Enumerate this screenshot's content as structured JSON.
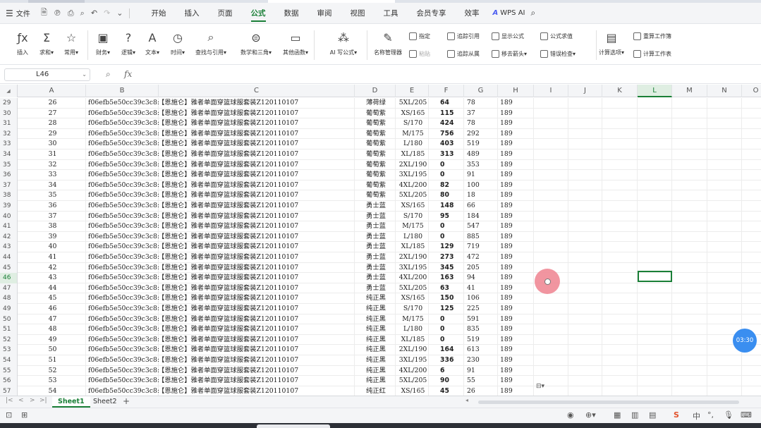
{
  "menubar": {
    "file_label": "文件",
    "tabs": [
      "开始",
      "插入",
      "页面",
      "公式",
      "数据",
      "审阅",
      "视图",
      "工具",
      "会员专享",
      "效率"
    ],
    "active_tab": "公式",
    "wps_ai_label": "WPS AI"
  },
  "ribbon": {
    "big_buttons": [
      {
        "label": "插入",
        "icon": "fx-icon"
      },
      {
        "label": "求和▾",
        "icon": "sum-icon"
      },
      {
        "label": "常用▾",
        "icon": "star-icon"
      },
      {
        "label": "财务▾",
        "icon": "finance-icon"
      },
      {
        "label": "逻辑▾",
        "icon": "logic-icon"
      },
      {
        "label": "文本▾",
        "icon": "text-icon"
      },
      {
        "label": "时间▾",
        "icon": "clock-icon"
      },
      {
        "label": "查找与引用▾",
        "icon": "lookup-icon"
      },
      {
        "label": "数学和三角▾",
        "icon": "math-icon"
      },
      {
        "label": "其他函数▾",
        "icon": "more-functions-icon"
      },
      {
        "label": "AI 写公式▾",
        "icon": "ai-formula-icon"
      },
      {
        "label": "名称管理器",
        "icon": "name-manager-icon"
      }
    ],
    "small_buttons": [
      {
        "label": "指定",
        "icon": "specify-icon"
      },
      {
        "label": "粘贴",
        "icon": "paste-icon"
      },
      {
        "label": "追踪引用",
        "icon": "trace-precedents-icon"
      },
      {
        "label": "显示公式",
        "icon": "show-formula-icon"
      },
      {
        "label": "公式求值",
        "icon": "evaluate-formula-icon"
      },
      {
        "label": "追踪从属",
        "icon": "trace-dependents-icon"
      },
      {
        "label": "移去箭头▾",
        "icon": "remove-arrows-icon"
      },
      {
        "label": "错误检查▾",
        "icon": "error-check-icon"
      }
    ],
    "calc_buttons": [
      {
        "label": "计算选项▾",
        "icon": "calc-options-icon"
      },
      {
        "label": "重算工作簿",
        "icon": "recalc-workbook-icon"
      },
      {
        "label": "计算工作表",
        "icon": "calc-sheet-icon"
      }
    ]
  },
  "formula_bar": {
    "cell_ref": "L46",
    "fx": "fx",
    "content": ""
  },
  "columns": [
    "A",
    "B",
    "C",
    "D",
    "E",
    "F",
    "G",
    "H",
    "I",
    "J",
    "K",
    "L",
    "M",
    "N",
    "O"
  ],
  "selected_column": "L",
  "selected_row": "46",
  "rows": [
    {
      "r": "29",
      "a": "26",
      "b": "f06efb5e50cc39c3c8:",
      "c": "【恩施仑】雅者单面穿篮球服套装Z120110107",
      "d": "薄荷绿",
      "e": "5XL/205",
      "f": "64",
      "g": "78",
      "h": "189"
    },
    {
      "r": "30",
      "a": "27",
      "b": "f06efb5e50cc39c3c8:",
      "c": "【恩施仑】雅者单面穿篮球服套装Z120110107",
      "d": "葡萄紫",
      "e": "XS/165",
      "f": "115",
      "g": "37",
      "h": "189"
    },
    {
      "r": "31",
      "a": "28",
      "b": "f06efb5e50cc39c3c8:",
      "c": "【恩施仑】雅者单面穿篮球服套装Z120110107",
      "d": "葡萄紫",
      "e": "S/170",
      "f": "424",
      "g": "78",
      "h": "189"
    },
    {
      "r": "32",
      "a": "29",
      "b": "f06efb5e50cc39c3c8:",
      "c": "【恩施仑】雅者单面穿篮球服套装Z120110107",
      "d": "葡萄紫",
      "e": "M/175",
      "f": "756",
      "g": "292",
      "h": "189"
    },
    {
      "r": "33",
      "a": "30",
      "b": "f06efb5e50cc39c3c8:",
      "c": "【恩施仑】雅者单面穿篮球服套装Z120110107",
      "d": "葡萄紫",
      "e": "L/180",
      "f": "403",
      "g": "519",
      "h": "189"
    },
    {
      "r": "34",
      "a": "31",
      "b": "f06efb5e50cc39c3c8:",
      "c": "【恩施仑】雅者单面穿篮球服套装Z120110107",
      "d": "葡萄紫",
      "e": "XL/185",
      "f": "313",
      "g": "489",
      "h": "189"
    },
    {
      "r": "35",
      "a": "32",
      "b": "f06efb5e50cc39c3c8:",
      "c": "【恩施仑】雅者单面穿篮球服套装Z120110107",
      "d": "葡萄紫",
      "e": "2XL/190",
      "f": "0",
      "g": "353",
      "h": "189"
    },
    {
      "r": "36",
      "a": "33",
      "b": "f06efb5e50cc39c3c8:",
      "c": "【恩施仑】雅者单面穿篮球服套装Z120110107",
      "d": "葡萄紫",
      "e": "3XL/195",
      "f": "0",
      "g": "91",
      "h": "189"
    },
    {
      "r": "37",
      "a": "34",
      "b": "f06efb5e50cc39c3c8:",
      "c": "【恩施仑】雅者单面穿篮球服套装Z120110107",
      "d": "葡萄紫",
      "e": "4XL/200",
      "f": "82",
      "g": "100",
      "h": "189"
    },
    {
      "r": "38",
      "a": "35",
      "b": "f06efb5e50cc39c3c8:",
      "c": "【恩施仑】雅者单面穿篮球服套装Z120110107",
      "d": "葡萄紫",
      "e": "5XL/205",
      "f": "80",
      "g": "18",
      "h": "189"
    },
    {
      "r": "39",
      "a": "36",
      "b": "f06efb5e50cc39c3c8:",
      "c": "【恩施仑】雅者单面穿篮球服套装Z120110107",
      "d": "勇士蓝",
      "e": "XS/165",
      "f": "148",
      "g": "66",
      "h": "189"
    },
    {
      "r": "40",
      "a": "37",
      "b": "f06efb5e50cc39c3c8:",
      "c": "【恩施仑】雅者单面穿篮球服套装Z120110107",
      "d": "勇士蓝",
      "e": "S/170",
      "f": "95",
      "g": "184",
      "h": "189"
    },
    {
      "r": "41",
      "a": "38",
      "b": "f06efb5e50cc39c3c8:",
      "c": "【恩施仑】雅者单面穿篮球服套装Z120110107",
      "d": "勇士蓝",
      "e": "M/175",
      "f": "0",
      "g": "547",
      "h": "189"
    },
    {
      "r": "42",
      "a": "39",
      "b": "f06efb5e50cc39c3c8:",
      "c": "【恩施仑】雅者单面穿篮球服套装Z120110107",
      "d": "勇士蓝",
      "e": "L/180",
      "f": "0",
      "g": "885",
      "h": "189"
    },
    {
      "r": "43",
      "a": "40",
      "b": "f06efb5e50cc39c3c8:",
      "c": "【恩施仑】雅者单面穿篮球服套装Z120110107",
      "d": "勇士蓝",
      "e": "XL/185",
      "f": "129",
      "g": "719",
      "h": "189"
    },
    {
      "r": "44",
      "a": "41",
      "b": "f06efb5e50cc39c3c8:",
      "c": "【恩施仑】雅者单面穿篮球服套装Z120110107",
      "d": "勇士蓝",
      "e": "2XL/190",
      "f": "273",
      "g": "472",
      "h": "189"
    },
    {
      "r": "45",
      "a": "42",
      "b": "f06efb5e50cc39c3c8:",
      "c": "【恩施仑】雅者单面穿篮球服套装Z120110107",
      "d": "勇士蓝",
      "e": "3XL/195",
      "f": "345",
      "g": "205",
      "h": "189"
    },
    {
      "r": "46",
      "a": "43",
      "b": "f06efb5e50cc39c3c8:",
      "c": "【恩施仑】雅者单面穿篮球服套装Z120110107",
      "d": "勇士蓝",
      "e": "4XL/200",
      "f": "163",
      "g": "94",
      "h": "189"
    },
    {
      "r": "47",
      "a": "44",
      "b": "f06efb5e50cc39c3c8:",
      "c": "【恩施仑】雅者单面穿篮球服套装Z120110107",
      "d": "勇士蓝",
      "e": "5XL/205",
      "f": "63",
      "g": "41",
      "h": "189"
    },
    {
      "r": "48",
      "a": "45",
      "b": "f06efb5e50cc39c3c8:",
      "c": "【恩施仑】雅者单面穿篮球服套装Z120110107",
      "d": "纯正黑",
      "e": "XS/165",
      "f": "150",
      "g": "106",
      "h": "189"
    },
    {
      "r": "49",
      "a": "46",
      "b": "f06efb5e50cc39c3c8:",
      "c": "【恩施仑】雅者单面穿篮球服套装Z120110107",
      "d": "纯正黑",
      "e": "S/170",
      "f": "125",
      "g": "225",
      "h": "189"
    },
    {
      "r": "50",
      "a": "47",
      "b": "f06efb5e50cc39c3c8:",
      "c": "【恩施仑】雅者单面穿篮球服套装Z120110107",
      "d": "纯正黑",
      "e": "M/175",
      "f": "0",
      "g": "591",
      "h": "189"
    },
    {
      "r": "51",
      "a": "48",
      "b": "f06efb5e50cc39c3c8:",
      "c": "【恩施仑】雅者单面穿篮球服套装Z120110107",
      "d": "纯正黑",
      "e": "L/180",
      "f": "0",
      "g": "835",
      "h": "189"
    },
    {
      "r": "52",
      "a": "49",
      "b": "f06efb5e50cc39c3c8:",
      "c": "【恩施仑】雅者单面穿篮球服套装Z120110107",
      "d": "纯正黑",
      "e": "XL/185",
      "f": "0",
      "g": "519",
      "h": "189"
    },
    {
      "r": "53",
      "a": "50",
      "b": "f06efb5e50cc39c3c8:",
      "c": "【恩施仑】雅者单面穿篮球服套装Z120110107",
      "d": "纯正黑",
      "e": "2XL/190",
      "f": "164",
      "g": "613",
      "h": "189"
    },
    {
      "r": "54",
      "a": "51",
      "b": "f06efb5e50cc39c3c8:",
      "c": "【恩施仑】雅者单面穿篮球服套装Z120110107",
      "d": "纯正黑",
      "e": "3XL/195",
      "f": "336",
      "g": "230",
      "h": "189"
    },
    {
      "r": "55",
      "a": "52",
      "b": "f06efb5e50cc39c3c8:",
      "c": "【恩施仑】雅者单面穿篮球服套装Z120110107",
      "d": "纯正黑",
      "e": "4XL/200",
      "f": "6",
      "g": "91",
      "h": "189"
    },
    {
      "r": "56",
      "a": "53",
      "b": "f06efb5e50cc39c3c8:",
      "c": "【恩施仑】雅者单面穿篮球服套装Z120110107",
      "d": "纯正黑",
      "e": "5XL/205",
      "f": "90",
      "g": "55",
      "h": "189"
    },
    {
      "r": "57",
      "a": "54",
      "b": "f06efb5e50cc39c3c8:",
      "c": "【恩施仑】雅者单面穿篮球服套装Z120110107",
      "d": "纯正红",
      "e": "XS/165",
      "f": "45",
      "g": "26",
      "h": "189"
    }
  ],
  "sheets": [
    "Sheet1",
    "Sheet2"
  ],
  "active_sheet": "Sheet1",
  "timer_label": "03:30",
  "status": {
    "ime_label": "中",
    "ime_logo": "S"
  },
  "colors": {
    "accent": "#1a7f37",
    "cursor_highlight": "#f08a96",
    "timer_bubble": "#3a8ef0"
  }
}
